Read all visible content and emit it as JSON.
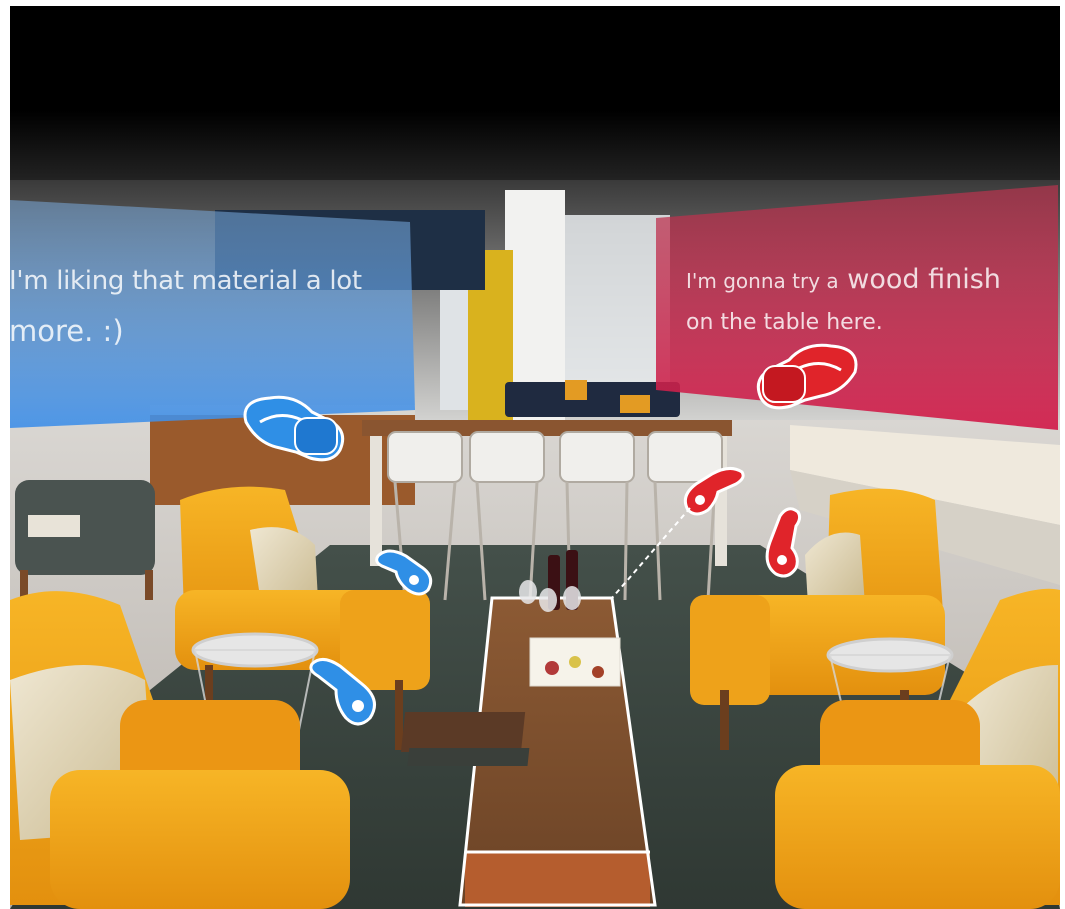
{
  "scene": "vr-collaborative-lounge-review",
  "colors": {
    "blue_user": "#2f8fe6",
    "red_user": "#e0242a",
    "chair": "#f0a418",
    "floor": "#c9c4bd",
    "rug": "#3b4540",
    "table_wood": "#7b4f2e",
    "ceiling": "#000000"
  },
  "chat": {
    "blue_user": {
      "line1": "I'm liking that material a lot",
      "line2": "more. :)",
      "avatar_icon": "vr-headset-icon",
      "controller_icon": "vr-controller-icon"
    },
    "red_user": {
      "line1_prefix": "I'm gonna try a",
      "line1_rest": "wood finish",
      "line2": "on the table here.",
      "avatar_icon": "vr-headset-icon",
      "controller_icon": "vr-controller-icon"
    }
  },
  "selection": {
    "selected_object": "coffee-table",
    "outline_color": "#ffffff"
  }
}
